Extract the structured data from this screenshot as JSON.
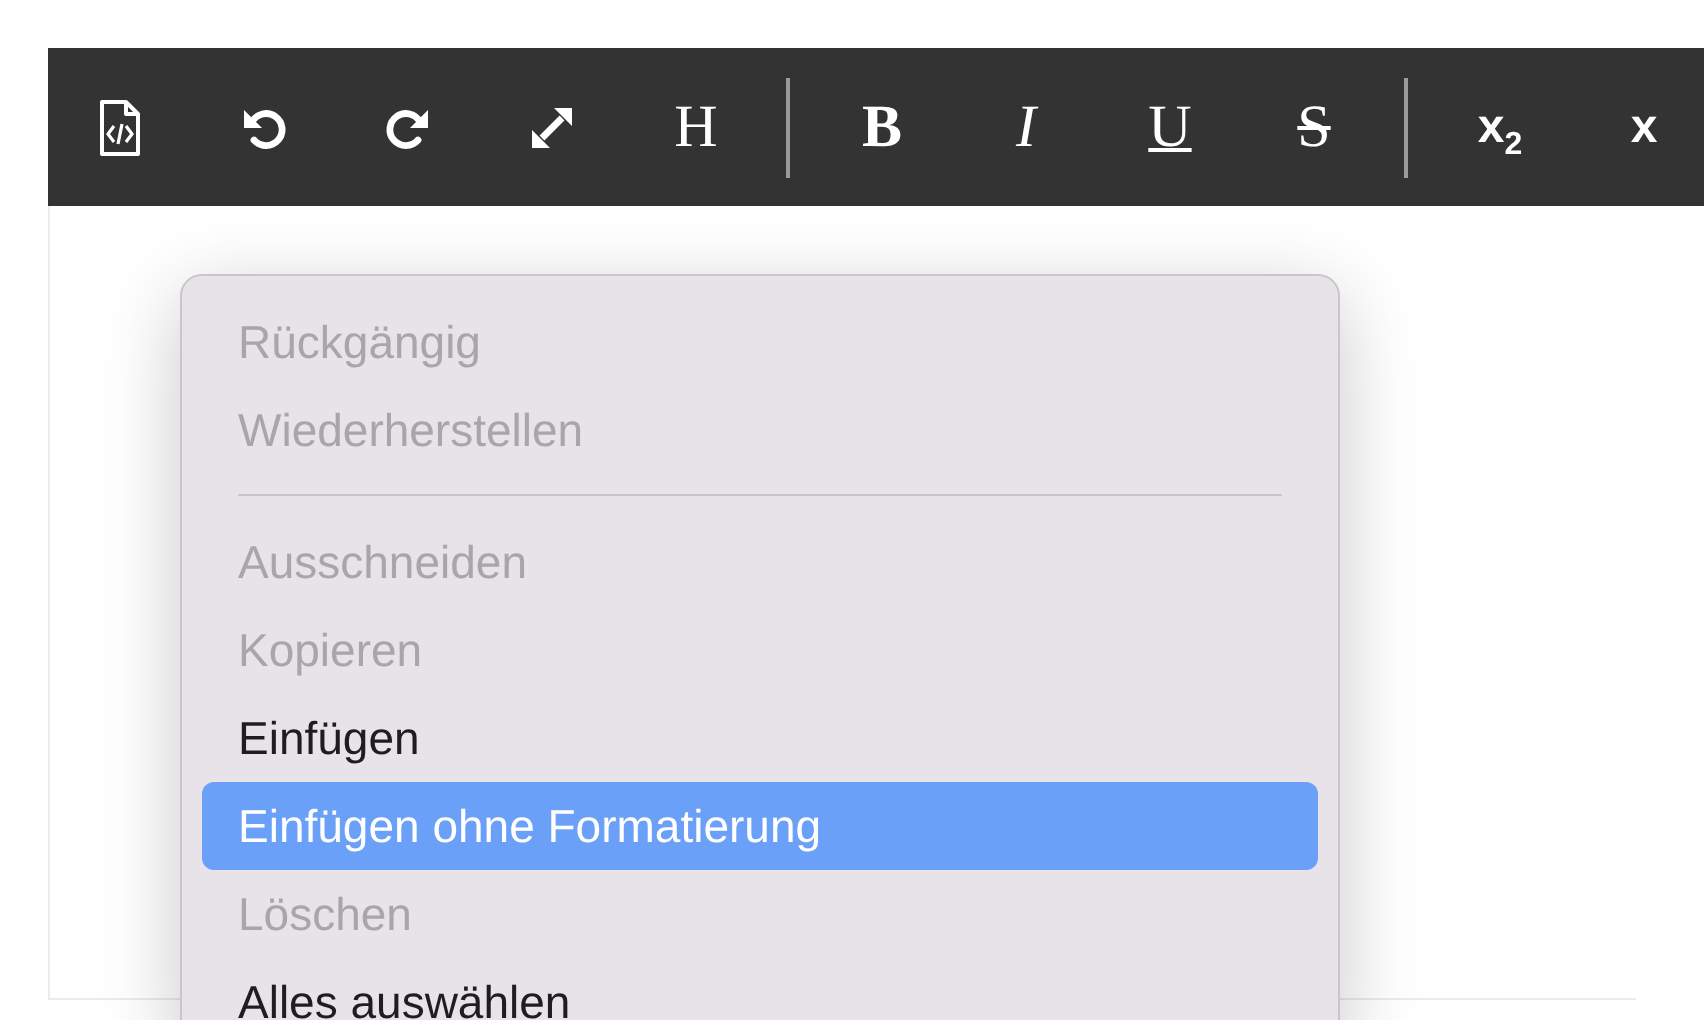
{
  "toolbar": [
    {
      "kind": "heading",
      "label": "H"
    },
    {
      "kind": "divider"
    },
    {
      "kind": "bold",
      "label": "B"
    },
    {
      "kind": "italic",
      "label": "I"
    },
    {
      "kind": "underline",
      "label": "U"
    },
    {
      "kind": "strike",
      "label": "S"
    },
    {
      "kind": "divider"
    },
    {
      "kind": "subscript",
      "label": "x$_{2}$"
    },
    {
      "kind": "superscript",
      "label": "x"
    }
  ],
  "context_menu": [
    {
      "kind": "item",
      "label": "Rückgängig",
      "disabled": true,
      "selected": false
    },
    {
      "kind": "item",
      "label": "Wiederherstellen",
      "disabled": true,
      "selected": false
    },
    {
      "kind": "separator"
    },
    {
      "kind": "item",
      "label": "Ausschneiden",
      "disabled": true,
      "selected": false
    },
    {
      "kind": "item",
      "label": "Kopieren",
      "disabled": true,
      "selected": false
    },
    {
      "kind": "item",
      "label": "Einfügen",
      "disabled": false,
      "selected": false
    },
    {
      "kind": "item",
      "label": "Einfügen ohne Formatierung",
      "disabled": false,
      "selected": true
    },
    {
      "kind": "item",
      "label": "Löschen",
      "disabled": true,
      "selected": false
    },
    {
      "kind": "item",
      "label": "Alles auswählen",
      "disabled": false,
      "selected": false
    }
  ]
}
